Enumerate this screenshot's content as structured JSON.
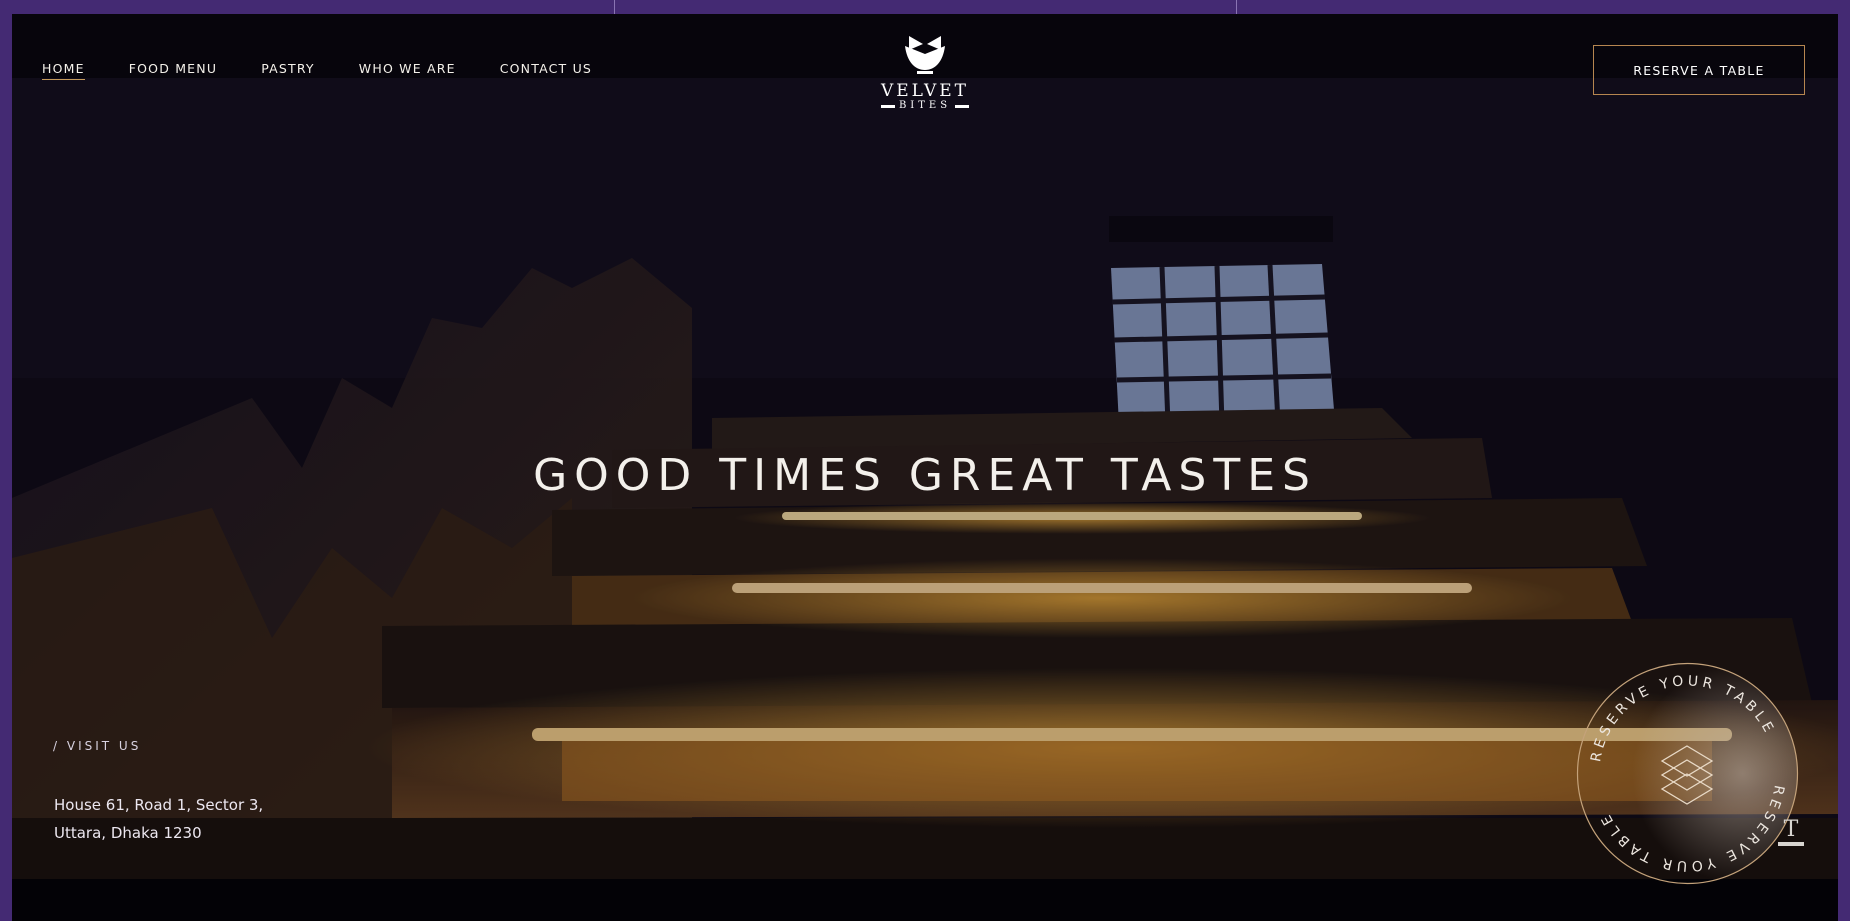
{
  "brand": {
    "name": "VELVET",
    "sub": "BITES"
  },
  "nav": {
    "items": [
      {
        "label": "HOME",
        "active": true
      },
      {
        "label": "FOOD MENU",
        "active": false
      },
      {
        "label": "PASTRY",
        "active": false
      },
      {
        "label": "WHO WE ARE",
        "active": false
      },
      {
        "label": "CONTACT US",
        "active": false
      }
    ]
  },
  "header": {
    "reserve_label": "RESERVE A TABLE"
  },
  "hero": {
    "headline": "GOOD TIMES GREAT TASTES",
    "visit_label": "/ VISIT US",
    "address_line1": "House 61, Road 1, Sector 3,",
    "address_line2": "Uttara, Dhaka 1230"
  },
  "badge": {
    "ring_text": "RESERVE YOUR TABLE",
    "icon": "layered-diamonds-icon"
  },
  "corner_widget": {
    "icon": "text-tool-icon",
    "glyph": "T"
  },
  "colors": {
    "frame": "#442a73",
    "accent": "#c59a5b",
    "background": "#07050c",
    "glow": "#f2a830"
  }
}
